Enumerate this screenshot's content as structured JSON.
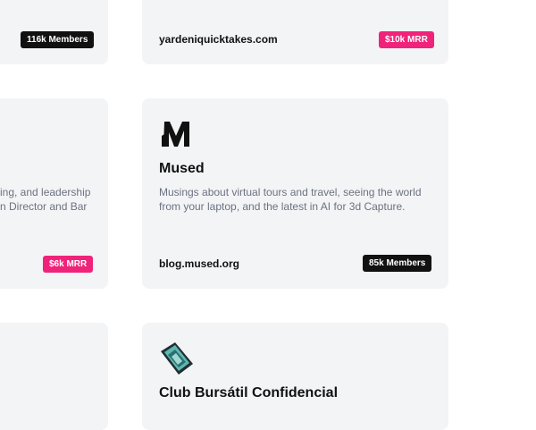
{
  "cards": {
    "top_left": {
      "badge": "116k Members"
    },
    "top_right": {
      "domain": "yardeniquicktakes.com",
      "badge": "$10k MRR"
    },
    "mid_left": {
      "desc_line1": "ing, and leadership",
      "desc_line2": "n Director and Bar",
      "badge": "$6k MRR"
    },
    "mid_right": {
      "logo_letter": "M",
      "title": "Mused",
      "desc": "Musings about virtual tours and travel, seeing the world from your laptop, and the latest in AI for 3d Capture.",
      "domain": "blog.mused.org",
      "badge": "85k Members"
    },
    "bottom_right": {
      "title": "Club Bursátil Confidencial"
    }
  },
  "colors": {
    "card_bg": "#f3f4f6",
    "badge_dark": "#111111",
    "badge_pink": "#f0237a",
    "desc_text": "#6b7280"
  },
  "icons": {
    "mused_logo": "mused-logo-icon",
    "club_logo": "club-bursatil-logo-icon"
  }
}
